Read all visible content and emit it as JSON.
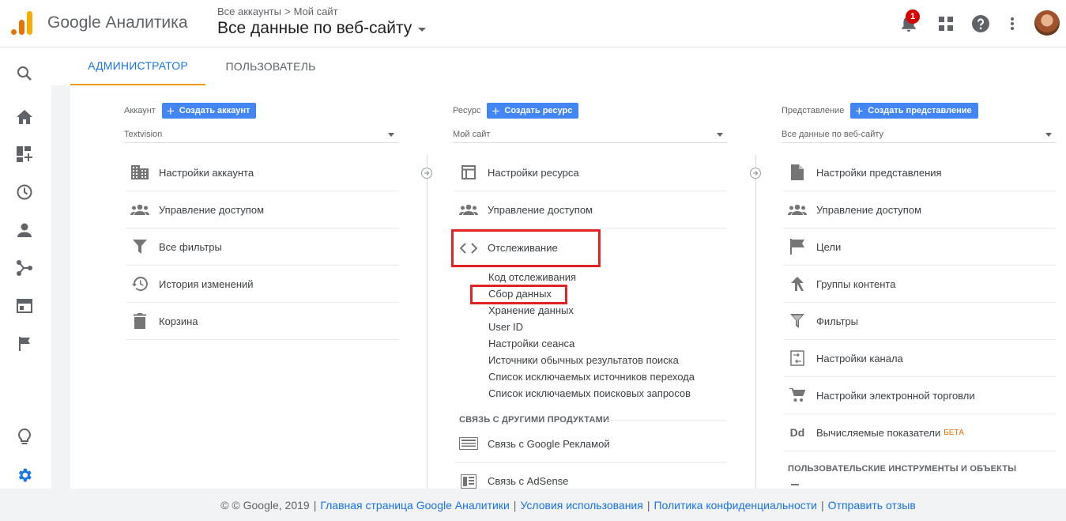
{
  "header": {
    "product": "Google Аналитика",
    "breadcrumb": [
      "Все аккаунты",
      "Мой сайт"
    ],
    "breadcrumb_sep": ">",
    "view_title": "Все данные по веб-сайту",
    "notification_count": "1",
    "brand_colors": {
      "logo_dark": "#e37400",
      "logo_light": "#f9ab00"
    }
  },
  "nav": {
    "icons": [
      "search-icon",
      "home-icon",
      "customization-icon",
      "realtime-icon",
      "audience-icon",
      "acquisition-icon",
      "behavior-icon",
      "conversions-icon",
      "discover-icon",
      "admin-icon",
      "expand-icon"
    ]
  },
  "tabs": [
    {
      "label": "АДМИНИСТРАТОР",
      "active": true
    },
    {
      "label": "ПОЛЬЗОВАТЕЛЬ",
      "active": false
    }
  ],
  "account": {
    "header": "Аккаунт",
    "create_label": "Создать аккаунт",
    "selected": "Textvision",
    "items": [
      {
        "label": "Настройки аккаунта",
        "icon": "building-icon"
      },
      {
        "label": "Управление доступом",
        "icon": "people-icon"
      },
      {
        "label": "Все фильтры",
        "icon": "filter-icon"
      },
      {
        "label": "История изменений",
        "icon": "history-icon"
      },
      {
        "label": "Корзина",
        "icon": "trash-icon"
      }
    ]
  },
  "property": {
    "header": "Ресурс",
    "create_label": "Создать ресурс",
    "selected": "Мой сайт",
    "items": [
      {
        "label": "Настройки ресурса",
        "icon": "layout-icon"
      },
      {
        "label": "Управление доступом",
        "icon": "people-icon"
      },
      {
        "label": "Отслеживание",
        "icon": "code-icon"
      }
    ],
    "tracking_sub": [
      "Код отслеживания",
      "Сбор данных",
      "Хранение данных",
      "User ID",
      "Настройки сеанса",
      "Источники обычных результатов поиска",
      "Список исключаемых источников перехода",
      "Список исключаемых поисковых запросов"
    ],
    "links_section": "СВЯЗЬ С ДРУГИМИ ПРОДУКТАМИ",
    "links": [
      {
        "label": "Связь с Google Рекламой",
        "icon": "ads-icon"
      },
      {
        "label": "Связь с AdSense",
        "icon": "adsense-icon"
      }
    ]
  },
  "view": {
    "header": "Представление",
    "create_label": "Создать представление",
    "selected": "Все данные по веб-сайту",
    "items": [
      {
        "label": "Настройки представления",
        "icon": "document-icon"
      },
      {
        "label": "Управление доступом",
        "icon": "people-icon"
      },
      {
        "label": "Цели",
        "icon": "flag-icon"
      },
      {
        "label": "Группы контента",
        "icon": "content-group-icon"
      },
      {
        "label": "Фильтры",
        "icon": "filter-icon"
      },
      {
        "label": "Настройки канала",
        "icon": "channel-icon"
      },
      {
        "label": "Настройки электронной торговли",
        "icon": "cart-icon"
      },
      {
        "label": "Вычисляемые показатели",
        "icon": "dd-icon",
        "badge": "БЕТА",
        "icon_text": "Dd"
      }
    ],
    "tools_section": "ПОЛЬЗОВАТЕЛЬСКИЕ ИНСТРУМЕНТЫ И ОБЪЕКТЫ"
  },
  "footer": {
    "copyright": "© © Google, 2019",
    "links": [
      "Главная страница Google Аналитики",
      "Условия использования",
      "Политика конфиденциальности",
      "Отправить отзыв"
    ],
    "sep": "|"
  }
}
